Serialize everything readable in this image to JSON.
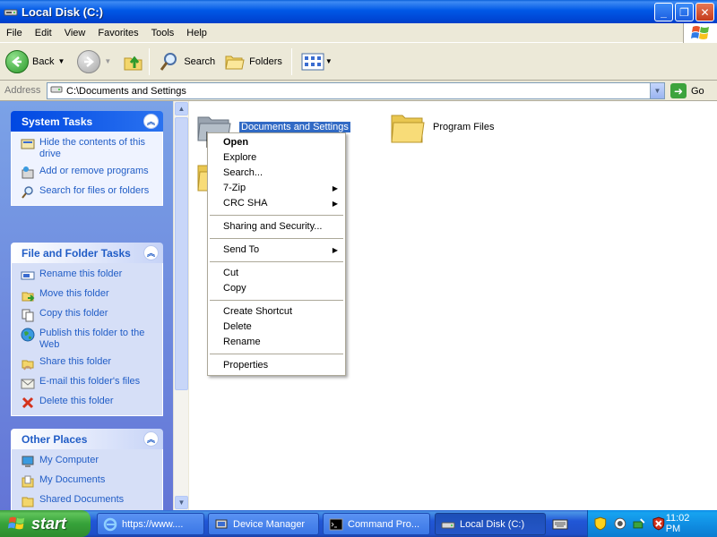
{
  "window": {
    "title": "Local Disk (C:)",
    "buttons": {
      "minimize": "_",
      "maximize": "❐",
      "close": "✕"
    }
  },
  "menubar": {
    "items": [
      "File",
      "Edit",
      "View",
      "Favorites",
      "Tools",
      "Help"
    ]
  },
  "toolbar": {
    "back_label": "Back",
    "search_label": "Search",
    "folders_label": "Folders"
  },
  "address": {
    "label": "Address",
    "value": "C:\\Documents and Settings",
    "go_label": "Go"
  },
  "sidebar": {
    "system_tasks": {
      "title": "System Tasks",
      "items": [
        "Hide the contents of this drive",
        "Add or remove programs",
        "Search for files or folders"
      ]
    },
    "file_folder_tasks": {
      "title": "File and Folder Tasks",
      "items": [
        "Rename this folder",
        "Move this folder",
        "Copy this folder",
        "Publish this folder to the Web",
        "Share this folder",
        "E-mail this folder's files",
        "Delete this folder"
      ]
    },
    "other_places": {
      "title": "Other Places",
      "items": [
        "My Computer",
        "My Documents",
        "Shared Documents"
      ]
    }
  },
  "files": {
    "items": [
      "Documents and Settings",
      "Program Files"
    ]
  },
  "context_menu": {
    "items": [
      "Open",
      "Explore",
      "Search...",
      "7-Zip",
      "CRC SHA",
      "Sharing and Security...",
      "Send To",
      "Cut",
      "Copy",
      "Create Shortcut",
      "Delete",
      "Rename",
      "Properties"
    ]
  },
  "taskbar": {
    "start_label": "start",
    "tasks": [
      "https://www....",
      "Device Manager",
      "Command Pro...",
      "Local Disk (C:)"
    ],
    "clock": "11:02 PM"
  },
  "colors": {
    "titlebar": "#0058E6",
    "sidebar_link": "#215DC6",
    "selection": "#316AC5",
    "taskbar": "#2157D7",
    "start_button": "#36A23A"
  }
}
